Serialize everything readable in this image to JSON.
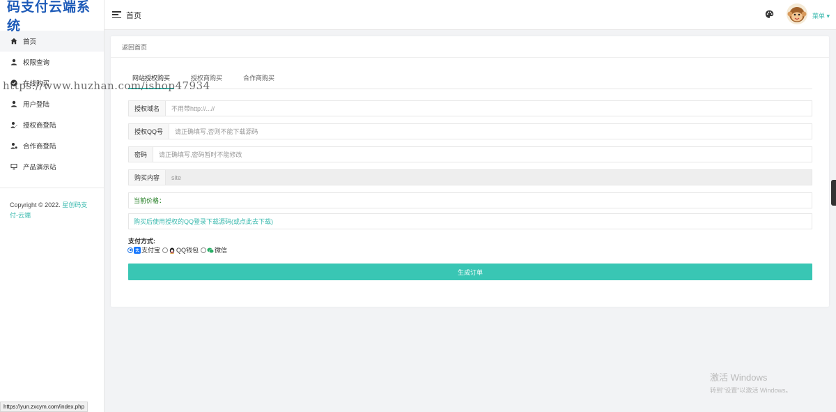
{
  "brand": "码支付云端系统",
  "header": {
    "title": "首页",
    "menu_label": "菜单"
  },
  "sidebar": {
    "items": [
      {
        "label": "首页",
        "icon": "home-icon"
      },
      {
        "label": "权限查询",
        "icon": "user-icon"
      },
      {
        "label": "在线购买",
        "icon": "check-circle-icon"
      },
      {
        "label": "用户登陆",
        "icon": "user-icon"
      },
      {
        "label": "授权商登陆",
        "icon": "user-pen-icon"
      },
      {
        "label": "合作商登陆",
        "icon": "user-gear-icon"
      },
      {
        "label": "产品演示站",
        "icon": "monitor-icon"
      }
    ],
    "copyright": "Copyright © 2022.",
    "copyright_link": "星创码支付-云端"
  },
  "card": {
    "back_link": "返回首页",
    "tabs": [
      "网站授权购买",
      "授权商购买",
      "合作商购买"
    ],
    "fields": {
      "domain": {
        "label": "授权域名",
        "placeholder": "不用带http://...//"
      },
      "qq": {
        "label": "授权QQ号",
        "placeholder": "请正确填写,否则不能下载源码"
      },
      "password": {
        "label": "密码",
        "placeholder": "请正确填写,密码暂时不能修改"
      },
      "content": {
        "label": "购买内容",
        "value": "site"
      }
    },
    "price_label": "当前价格：",
    "note": "购买后使用授权的QQ登录下载源码(或点此去下载)",
    "payment": {
      "title": "支付方式:",
      "options": [
        "支付宝",
        "QQ钱包",
        "微信"
      ]
    },
    "submit": "生成订单"
  },
  "overlay": {
    "watermark": "https://www.huzhan.com/ishop47934",
    "win_title": "激活 Windows",
    "win_sub": "转到\"设置\"以激活 Windows。",
    "status_url": "https://yun.zxcym.com/index.php"
  },
  "colors": {
    "accent": "#39c6b4",
    "brand": "#1e5bb8",
    "price": "#1c7a1c",
    "link": "#39b9ae"
  }
}
